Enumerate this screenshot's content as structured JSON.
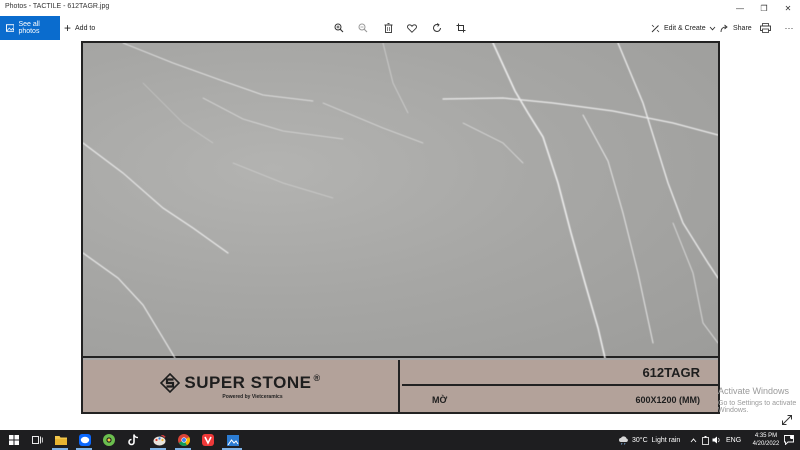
{
  "window": {
    "title": "Photos - TACTILE - 612TAGR.jpg",
    "minimize_glyph": "—",
    "maximize_glyph": "❐",
    "close_glyph": "✕"
  },
  "toolbar": {
    "see_all_label": "See all photos",
    "add_to_label": "Add to",
    "add_to_glyph": "+",
    "edit_create_label": "Edit & Create",
    "share_label": "Share",
    "more_glyph": "···",
    "icons": [
      "zoom-in-icon",
      "zoom-out-icon",
      "delete-icon",
      "heart-icon",
      "rotate-icon",
      "crop-icon",
      "edit-create-icon",
      "share-icon",
      "print-icon",
      "more-icon"
    ]
  },
  "photo": {
    "brand_name": "SUPER STONE",
    "brand_reg": "®",
    "powered_by": "Powered by Vietceramics",
    "product_code": "612TAGR",
    "finish": "MỜ",
    "size": "600X1200 (MM)",
    "colors": {
      "stone": "#a8a8a8",
      "label_bg": "#b3a29a",
      "border": "#222222"
    }
  },
  "watermark": {
    "line1": "Activate Windows",
    "line2": "Go to Settings to activate Windows."
  },
  "taskbar": {
    "apps": [
      "windows-start-icon",
      "task-view-icon",
      "file-explorer-icon",
      "zalo-icon",
      "android-icon",
      "tiktok-icon",
      "paint-icon",
      "chrome-icon",
      "vivaldi-icon",
      "photos-icon"
    ],
    "weather": "30°C  Light rain",
    "language": "ENG",
    "time": "4:35 PM",
    "date": "4/20/2022",
    "colors": {
      "background": "#1e1e20",
      "accent": "#0a6cce"
    }
  }
}
